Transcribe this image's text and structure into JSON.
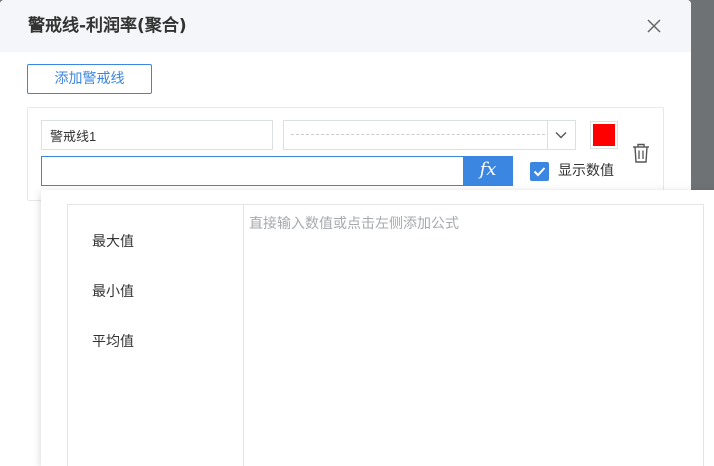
{
  "dialog": {
    "title": "警戒线-利润率(聚合)",
    "close_icon": "close-icon"
  },
  "toolbar": {
    "add_label": "添加警戒线"
  },
  "line": {
    "name_value": "警戒线1",
    "style_value": "dashed",
    "color": "#ff0000",
    "formula_value": "",
    "fx_label": "fx",
    "show_value_checked": true,
    "show_value_label": "显示数值"
  },
  "formula_popup": {
    "functions": [
      "最大值",
      "最小值",
      "平均值"
    ],
    "placeholder": "直接输入数值或点击左侧添加公式"
  },
  "colors": {
    "accent": "#3b86e0",
    "swatch": "#ff0000",
    "overlay": "#6d7073"
  }
}
